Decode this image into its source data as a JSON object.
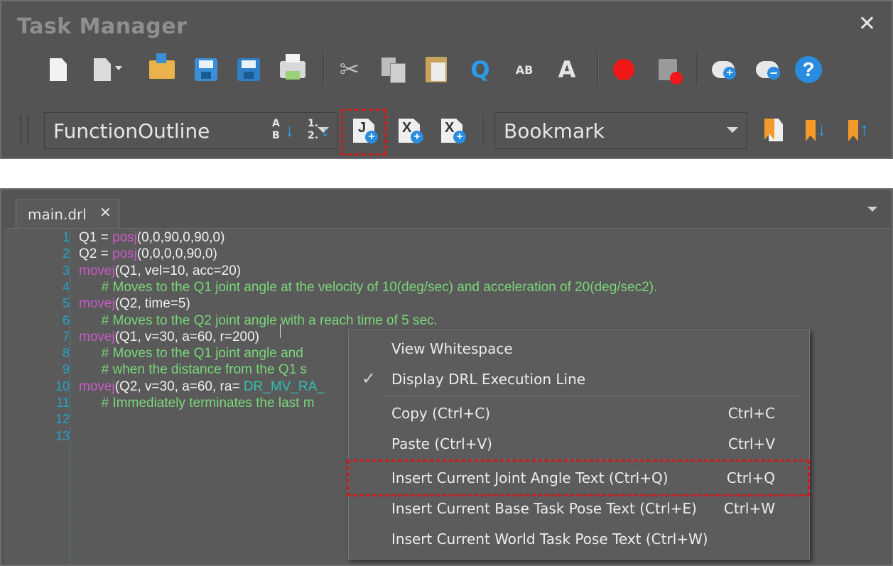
{
  "task_manager": {
    "title": "Task Manager",
    "close_glyph": "✕",
    "toolbar": {
      "icons": [
        "new-file-icon",
        "open-recent-icon",
        "open-folder-icon",
        "save-icon",
        "save-as-icon",
        "print-icon",
        "cut-icon",
        "copy-icon",
        "paste-icon",
        "find-icon",
        "replace-icon",
        "font-size-icon",
        "record-icon",
        "delete-breakpoint-icon",
        "add-comment-icon",
        "remove-comment-icon",
        "help-icon"
      ]
    },
    "function_outline": {
      "value": "FunctionOutline"
    },
    "bookmark": {
      "value": "Bookmark"
    },
    "sort_labels": {
      "alpha_top": "A",
      "alpha_bottom": "B",
      "num_top": "1.",
      "num_bottom": "2."
    },
    "insert_labels": {
      "joint": "J",
      "base": "X",
      "world": "X"
    },
    "find_glyph": "Q",
    "replace_glyph": "AB",
    "font_glyph": "A",
    "plus_glyph": "+",
    "help_glyph": "?"
  },
  "editor": {
    "tab_label": "main.drl",
    "tab_close": "✕",
    "lines": [
      {
        "n": "1",
        "parts": [
          {
            "t": "Q1 = ",
            "c": "plain"
          },
          {
            "t": "posj",
            "c": "kw"
          },
          {
            "t": "(0,0,90,0,90,0)",
            "c": "plain"
          }
        ]
      },
      {
        "n": "2",
        "parts": [
          {
            "t": "Q2 = ",
            "c": "plain"
          },
          {
            "t": "posj",
            "c": "kw"
          },
          {
            "t": "(0,0,0,0,90,0)",
            "c": "plain"
          }
        ]
      },
      {
        "n": "3",
        "parts": [
          {
            "t": "movej",
            "c": "kw"
          },
          {
            "t": "(Q1, vel=10, acc=20)",
            "c": "plain"
          }
        ]
      },
      {
        "n": "4",
        "parts": [
          {
            "t": "      # Moves to the Q1 joint angle at the velocity of 10(deg/sec) and acceleration of 20(deg/sec2).",
            "c": "cm"
          }
        ]
      },
      {
        "n": "5",
        "parts": [
          {
            "t": "movej",
            "c": "kw"
          },
          {
            "t": "(Q2, time=5)",
            "c": "plain"
          }
        ]
      },
      {
        "n": "6",
        "parts": [
          {
            "t": "      # Moves to the Q2 joint angle with a reach time of 5 sec.",
            "c": "cm"
          }
        ]
      },
      {
        "n": "7",
        "parts": [
          {
            "t": "movej",
            "c": "kw"
          },
          {
            "t": "(Q1, v=30, a=60, r=200)",
            "c": "plain"
          }
        ]
      },
      {
        "n": "8",
        "parts": [
          {
            "t": "      # Moves to the Q1 joint angle and",
            "c": "cm"
          }
        ]
      },
      {
        "n": "9",
        "parts": [
          {
            "t": "      # when the distance from the Q1 s",
            "c": "cm"
          }
        ]
      },
      {
        "n": "10",
        "parts": [
          {
            "t": "movej",
            "c": "kw"
          },
          {
            "t": "(Q2, v=30, a=60, ra= ",
            "c": "plain"
          },
          {
            "t": "DR_MV_RA_",
            "c": "cn"
          }
        ]
      },
      {
        "n": "11",
        "parts": [
          {
            "t": "      # Immediately terminates the last m",
            "c": "cm"
          }
        ]
      },
      {
        "n": "12",
        "parts": []
      },
      {
        "n": "13",
        "parts": []
      }
    ]
  },
  "context_menu": {
    "check_glyph": "✓",
    "items": [
      {
        "label": "View Whitespace",
        "shortcut": "",
        "checked": false
      },
      {
        "label": "Display DRL Execution Line",
        "shortcut": "",
        "checked": true
      },
      {
        "label": "Copy (Ctrl+C)",
        "shortcut": "Ctrl+C",
        "checked": false
      },
      {
        "label": "Paste (Ctrl+V)",
        "shortcut": "Ctrl+V",
        "checked": false
      },
      {
        "label": "Insert Current Joint Angle Text (Ctrl+Q)",
        "shortcut": "Ctrl+Q",
        "checked": false
      },
      {
        "label": "Insert Current Base Task Pose Text (Ctrl+E)",
        "shortcut": "Ctrl+W",
        "checked": false
      },
      {
        "label": "Insert Current World Task Pose Text (Ctrl+W)",
        "shortcut": "",
        "checked": false
      }
    ]
  },
  "colors": {
    "panel_bg": "#545454",
    "highlight_dash": "#c81e1e",
    "keyword": "#c85ac8",
    "comment": "#7ad67a",
    "line_number": "#2aa0c8",
    "constant": "#2ec0b4"
  }
}
